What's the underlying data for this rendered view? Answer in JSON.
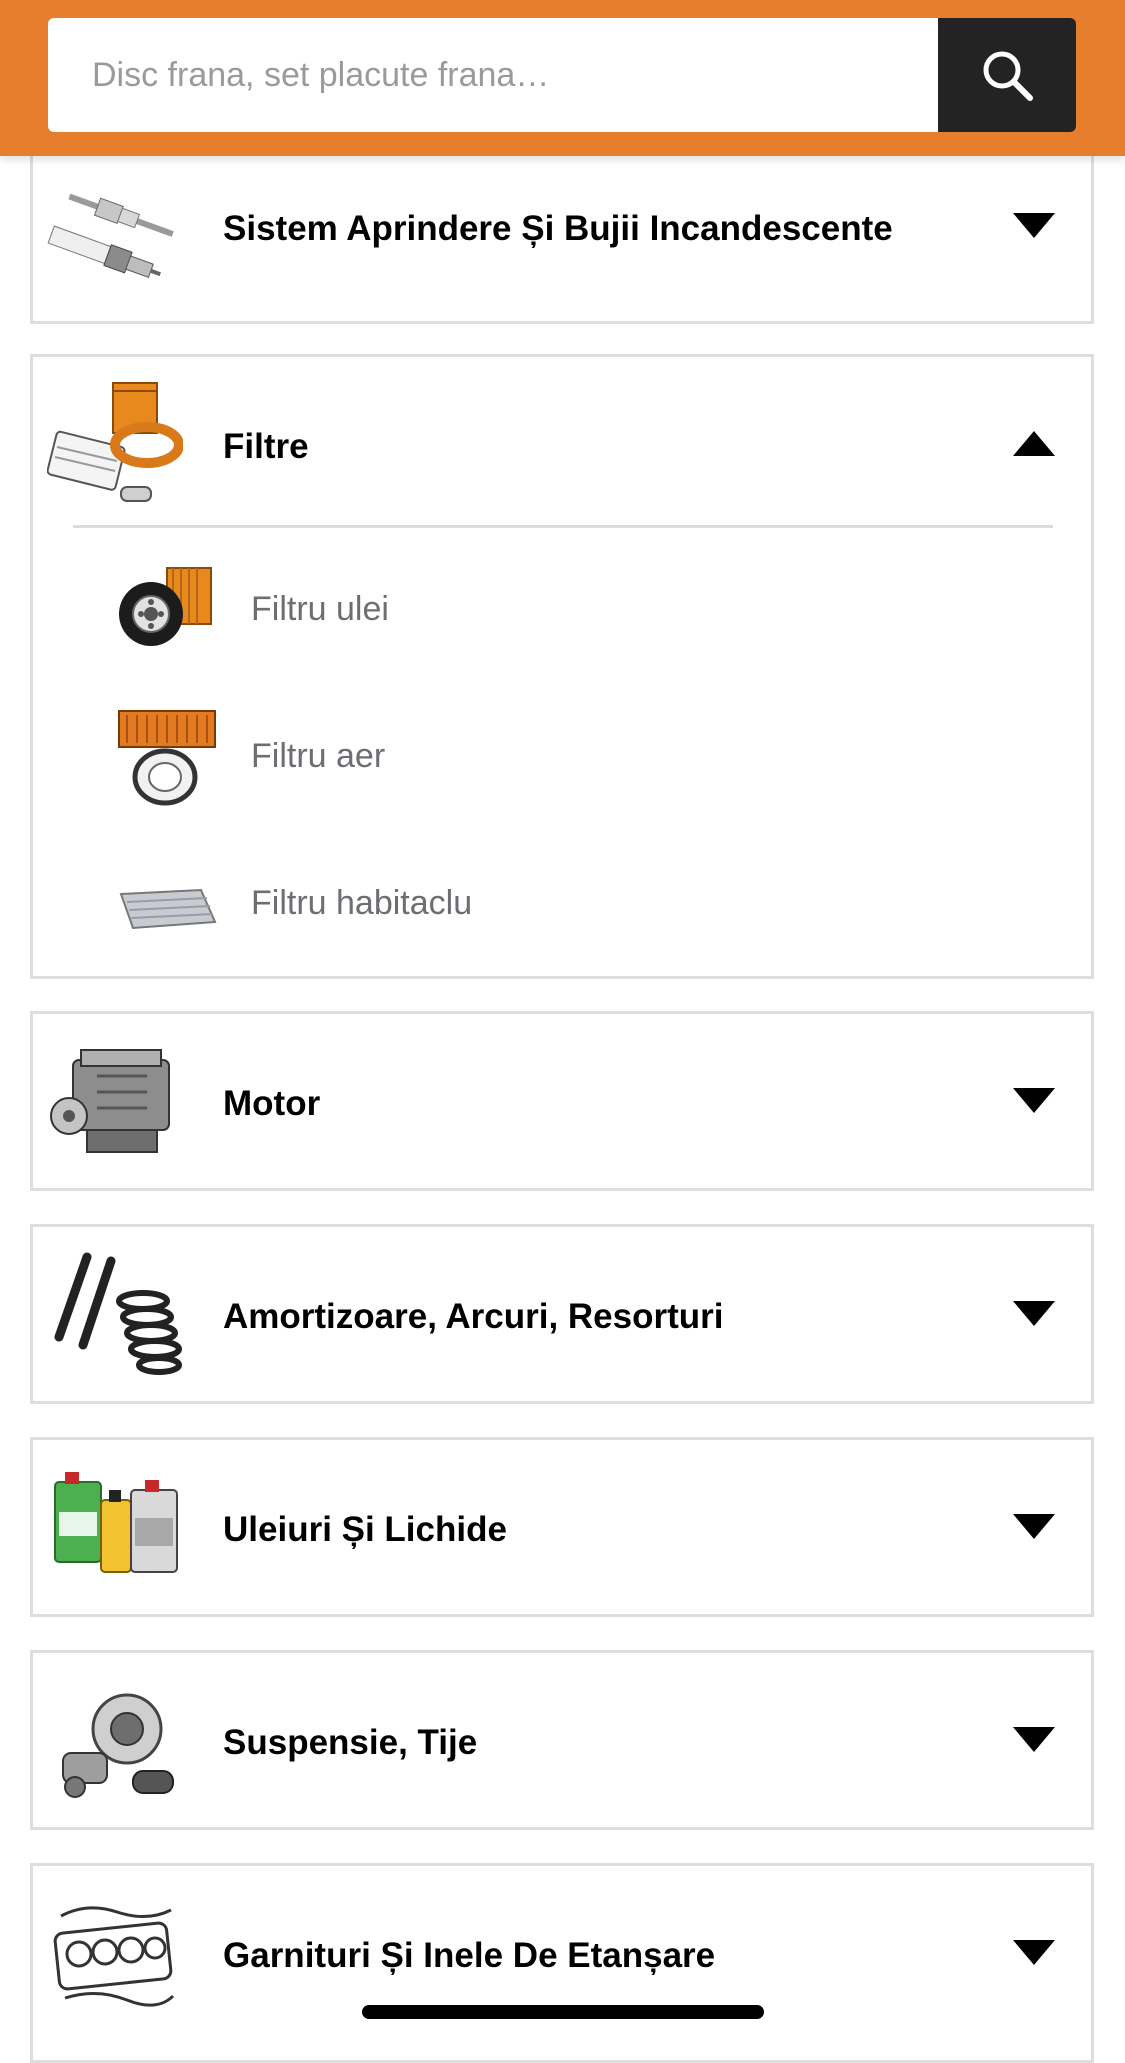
{
  "search": {
    "placeholder": "Disc frana, set placute frana…"
  },
  "colors": {
    "header_bg": "#e67e2e",
    "search_button_bg": "#232323",
    "card_border": "#dedede",
    "sub_label": "#6d6d72"
  },
  "categories": [
    {
      "title": "Sistem Aprindere Și Bujii Incandescente",
      "icon": "spark-plug-glow-plug-icon",
      "expanded": false
    },
    {
      "title": "Filtre",
      "icon": "filters-icon",
      "expanded": true,
      "items": [
        {
          "label": "Filtru ulei",
          "icon": "oil-filter-icon"
        },
        {
          "label": "Filtru aer",
          "icon": "air-filter-icon"
        },
        {
          "label": "Filtru habitaclu",
          "icon": "cabin-filter-icon"
        }
      ]
    },
    {
      "title": "Motor",
      "icon": "engine-icon",
      "expanded": false
    },
    {
      "title": "Amortizoare, Arcuri, Resorturi",
      "icon": "shock-absorber-spring-icon",
      "expanded": false
    },
    {
      "title": "Uleiuri Și Lichide",
      "icon": "oil-fluids-icon",
      "expanded": false
    },
    {
      "title": "Suspensie, Tije",
      "icon": "suspension-icon",
      "expanded": false
    },
    {
      "title": "Garnituri Și Inele De Etanșare",
      "icon": "gasket-icon",
      "expanded": false
    }
  ]
}
